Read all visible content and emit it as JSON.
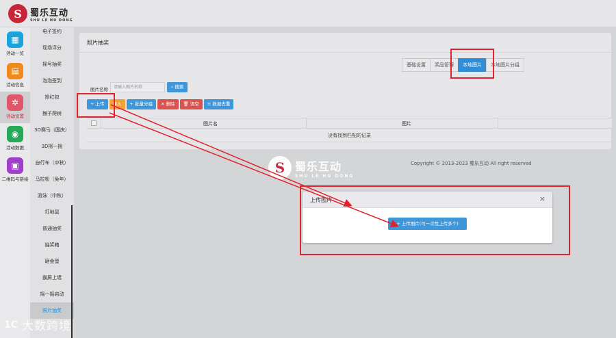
{
  "brand": {
    "logo_glyph": "S",
    "name_cn": "蜀乐互动",
    "name_en": "SHU LE HU DONG",
    "accent": "#c7253a"
  },
  "rail": [
    {
      "label": "活动一览",
      "icon": "grid-icon",
      "color": "#1ba3dd",
      "glyph": "▦"
    },
    {
      "label": "活动信息",
      "icon": "document-icon",
      "color": "#f08a1c",
      "glyph": "▤"
    },
    {
      "label": "活动设置",
      "icon": "gear-icon",
      "color": "#e0566a",
      "glyph": "✲",
      "active": true
    },
    {
      "label": "活动数据",
      "icon": "database-icon",
      "color": "#27a95a",
      "glyph": "◉"
    },
    {
      "label": "二维码与链接",
      "icon": "qrcode-icon",
      "color": "#a13ecb",
      "glyph": "▣"
    }
  ],
  "submenu": [
    "电子签约",
    "现场评分",
    "摇号抽奖",
    "泡泡签到",
    "抢红包",
    "猴子爬树",
    "3D赛马（国庆）",
    "3D摇一摇",
    "自行车（中秋）",
    "马拉松（免年）",
    "游泳（中秋）",
    "打地鼠",
    "普通抽奖",
    "抽奖箱",
    "砸金蛋",
    "霸屏上墙",
    "摇一摇启动",
    "照片抽奖"
  ],
  "submenu_active": "照片抽奖",
  "panel": {
    "title": "照片抽奖",
    "tabs": [
      {
        "label": "基础设置",
        "active": false
      },
      {
        "label": "奖品管理",
        "active": false
      },
      {
        "label": "本地图片",
        "active": true
      },
      {
        "label": "本地图片分组",
        "active": false
      }
    ],
    "search_label": "图片名称",
    "search_placeholder": "请输入图片名称",
    "search_button": "搜索",
    "toolbar": [
      {
        "label": "+ 上传",
        "color": "#3f96d8"
      },
      {
        "label": "导入",
        "color": "#f0a33b"
      },
      {
        "label": "+ 批量分组",
        "color": "#3f96d8"
      },
      {
        "label": "✕ 删除",
        "color": "#d9534f"
      },
      {
        "label": "🗑 清空",
        "color": "#d9534f"
      },
      {
        "label": "≡ 数据去重",
        "color": "#3f96d8"
      }
    ],
    "table_headers": [
      "图片名",
      "图片"
    ],
    "empty_text": "没有找到匹配的记录"
  },
  "copyright": "Copyright © 2013-2023 蜀乐互动 All right reserved",
  "modal": {
    "title": "上传图片",
    "close": "×",
    "upload_button": "+ 上传图片(可一次性上传多个)"
  },
  "corner_watermark": {
    "logo": "1C",
    "text": "大数跨境"
  },
  "annotation_color": "#e0232e"
}
